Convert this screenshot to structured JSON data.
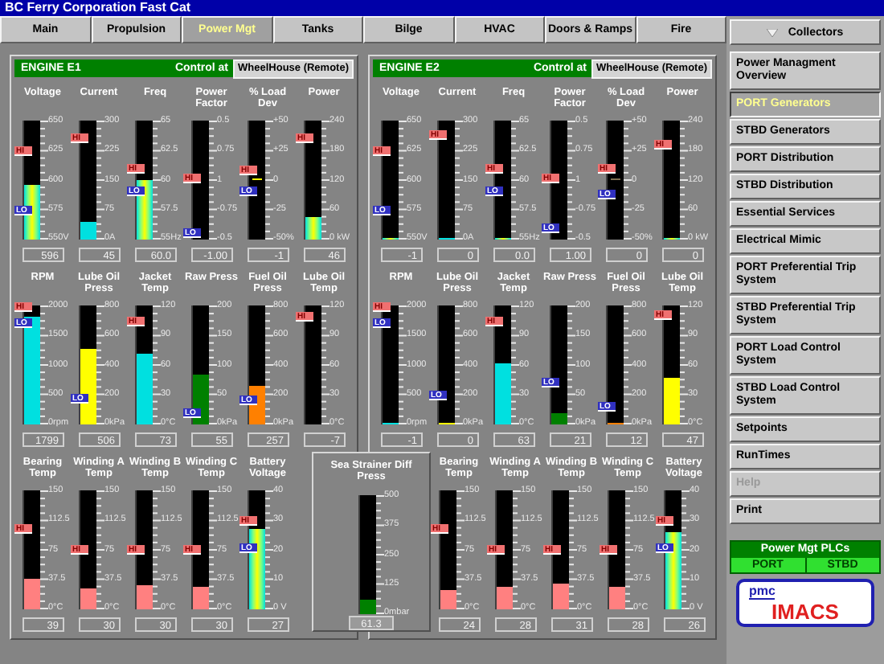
{
  "window": {
    "title": "BC Ferry Corporation Fast Cat"
  },
  "tabs": [
    {
      "label": "Main",
      "selected": false
    },
    {
      "label": "Propulsion",
      "selected": false
    },
    {
      "label": "Power Mgt",
      "selected": true
    },
    {
      "label": "Tanks",
      "selected": false
    },
    {
      "label": "Bilge",
      "selected": false
    },
    {
      "label": "HVAC",
      "selected": false
    },
    {
      "label": "Doors & Ramps",
      "selected": false
    },
    {
      "label": "Fire",
      "selected": false
    }
  ],
  "engines": [
    {
      "title": "ENGINE E1",
      "control_label": "Control at",
      "control_value": "WheelHouse (Remote)",
      "rows": [
        [
          {
            "label": "Voltage",
            "scale": [
              "650",
              "625",
              "600",
              "575",
              "550V"
            ],
            "kind": "gradient",
            "level": 0.46,
            "hi": {
              "label": "HI",
              "level": 0.75
            },
            "lo": {
              "label": "LO",
              "level": 0.25
            },
            "reading": "596"
          },
          {
            "label": "Current",
            "scale": [
              "300",
              "225",
              "150",
              "75",
              "0A"
            ],
            "kind": "solid",
            "color": "#00e0e0",
            "level": 0.15,
            "hi": {
              "label": "HI",
              "level": 0.85
            },
            "reading": "45"
          },
          {
            "label": "Freq",
            "scale": [
              "65",
              "62.5",
              "60",
              "57.5",
              "55Hz"
            ],
            "kind": "gradient",
            "level": 0.5,
            "hi": {
              "label": "HI",
              "level": 0.6
            },
            "lo": {
              "label": "LO",
              "level": 0.4
            },
            "reading": "60.0"
          },
          {
            "label": "Power Factor",
            "scale": [
              "0.5",
              "0.75",
              "1",
              "-0.75",
              "-0.5"
            ],
            "kind": "none",
            "hi": {
              "label": "HI",
              "level": 0.52
            },
            "lo": {
              "label": "LO",
              "level": 0.05
            },
            "reading": "-1.00"
          },
          {
            "label": "% Load Dev",
            "scale": [
              "+50",
              "+25",
              "0",
              "-25",
              "-50%"
            ],
            "kind": "line",
            "color": "#ffff00",
            "level": 0.5,
            "hi": {
              "label": "HI",
              "level": 0.58
            },
            "lo": {
              "label": "LO",
              "level": 0.4
            },
            "reading": "-1"
          },
          {
            "label": "Power",
            "scale": [
              "240",
              "180",
              "120",
              "60",
              "0 kW"
            ],
            "kind": "gradient",
            "level": 0.19,
            "hi": {
              "label": "HI",
              "level": 0.85
            },
            "reading": "46"
          }
        ],
        [
          {
            "label": "RPM",
            "scale": [
              "2000",
              "1500",
              "1000",
              "500",
              "0rpm"
            ],
            "kind": "solid",
            "color": "#00e0e0",
            "level": 0.9,
            "hi": {
              "label": "HI",
              "level": 0.98
            },
            "lo": {
              "label": "LO",
              "level": 0.85
            },
            "reading": "1799"
          },
          {
            "label": "Lube Oil Press",
            "scale": [
              "800",
              "600",
              "400",
              "200",
              "0kPa"
            ],
            "kind": "solid",
            "color": "#ffff00",
            "level": 0.63,
            "lo": {
              "label": "LO",
              "level": 0.22
            },
            "reading": "506"
          },
          {
            "label": "Jacket Temp",
            "scale": [
              "120",
              "90",
              "60",
              "30",
              "0°C"
            ],
            "kind": "solid",
            "color": "#00e0e0",
            "level": 0.6,
            "hi": {
              "label": "HI",
              "level": 0.87
            },
            "reading": "73"
          },
          {
            "label": "Raw Press",
            "scale": [
              "200",
              "150",
              "100",
              "50",
              "0kPa"
            ],
            "kind": "solid",
            "color": "#008000",
            "level": 0.42,
            "lo": {
              "label": "LO",
              "level": 0.1
            },
            "reading": "55"
          },
          {
            "label": "Fuel Oil Press",
            "scale": [
              "800",
              "600",
              "400",
              "200",
              "0kPa"
            ],
            "kind": "solid",
            "color": "#ff8000",
            "level": 0.32,
            "lo": {
              "label": "LO",
              "level": 0.2
            },
            "reading": "257"
          },
          {
            "label": "Lube Oil Temp",
            "scale": [
              "120",
              "90",
              "60",
              "30",
              "0°C"
            ],
            "kind": "none",
            "hi": {
              "label": "HI",
              "level": 0.9
            },
            "reading": "-7"
          }
        ]
      ],
      "lower_gauges": [
        {
          "label": "Bearing Temp",
          "scale": [
            "150",
            "112.5",
            "75",
            "37.5",
            "0°C"
          ],
          "kind": "solid",
          "color": "#ff8080",
          "level": 0.26,
          "hi": {
            "label": "HI",
            "level": 0.68
          },
          "reading": "39"
        },
        {
          "label": "Winding A Temp",
          "scale": [
            "150",
            "112.5",
            "75",
            "37.5",
            "0°C"
          ],
          "kind": "solid",
          "color": "#ff8080",
          "level": 0.18,
          "hi": {
            "label": "HI",
            "level": 0.5
          },
          "reading": "30"
        },
        {
          "label": "Winding B Temp",
          "scale": [
            "150",
            "112.5",
            "75",
            "37.5",
            "0°C"
          ],
          "kind": "solid",
          "color": "#ff8080",
          "level": 0.2,
          "hi": {
            "label": "HI",
            "level": 0.5
          },
          "reading": "30"
        },
        {
          "label": "Winding C Temp",
          "scale": [
            "150",
            "112.5",
            "75",
            "37.5",
            "0°C"
          ],
          "kind": "solid",
          "color": "#ff8080",
          "level": 0.19,
          "hi": {
            "label": "HI",
            "level": 0.5
          },
          "reading": "30"
        },
        {
          "label": "Battery Voltage",
          "scale": [
            "40",
            "30",
            "20",
            "10",
            "0 V"
          ],
          "kind": "gradient",
          "level": 0.68,
          "hi": {
            "label": "HI",
            "level": 0.75
          },
          "lo": {
            "label": "LO",
            "level": 0.52
          },
          "reading": "27"
        }
      ]
    },
    {
      "title": "ENGINE E2",
      "control_label": "Control at",
      "control_value": "WheelHouse (Remote)",
      "rows": [
        [
          {
            "label": "Voltage",
            "scale": [
              "650",
              "625",
              "600",
              "575",
              "550V"
            ],
            "kind": "gradient",
            "level": 0.01,
            "hi": {
              "label": "HI",
              "level": 0.75
            },
            "lo": {
              "label": "LO",
              "level": 0.25
            },
            "reading": "-1"
          },
          {
            "label": "Current",
            "scale": [
              "300",
              "225",
              "150",
              "75",
              "0A"
            ],
            "kind": "solid",
            "color": "#00e0e0",
            "level": 0.01,
            "hi": {
              "label": "HI",
              "level": 0.88
            },
            "reading": "0"
          },
          {
            "label": "Freq",
            "scale": [
              "65",
              "62.5",
              "60",
              "57.5",
              "55Hz"
            ],
            "kind": "gradient",
            "level": 0.01,
            "hi": {
              "label": "HI",
              "level": 0.6
            },
            "lo": {
              "label": "LO",
              "level": 0.4
            },
            "reading": "0.0"
          },
          {
            "label": "Power Factor",
            "scale": [
              "0.5",
              "0.75",
              "1",
              "-0.75",
              "-0.5"
            ],
            "kind": "none",
            "hi": {
              "label": "HI",
              "level": 0.52
            },
            "lo": {
              "label": "LO",
              "level": 0.1
            },
            "reading": "1.00"
          },
          {
            "label": "% Load Dev",
            "scale": [
              "+50",
              "+25",
              "0",
              "-25",
              "-50%"
            ],
            "kind": "line",
            "color": "#807050",
            "level": 0.5,
            "hi": {
              "label": "HI",
              "level": 0.6
            },
            "lo": {
              "label": "LO",
              "level": 0.38
            },
            "reading": "0"
          },
          {
            "label": "Power",
            "scale": [
              "240",
              "180",
              "120",
              "60",
              "0 kW"
            ],
            "kind": "gradient",
            "level": 0.01,
            "hi": {
              "label": "HI",
              "level": 0.8
            },
            "reading": "0"
          }
        ],
        [
          {
            "label": "RPM",
            "scale": [
              "2000",
              "1500",
              "1000",
              "500",
              "0rpm"
            ],
            "kind": "solid",
            "color": "#00e0e0",
            "level": 0.01,
            "hi": {
              "label": "HI",
              "level": 0.98
            },
            "lo": {
              "label": "LO",
              "level": 0.85
            },
            "reading": "-1"
          },
          {
            "label": "Lube Oil Press",
            "scale": [
              "800",
              "600",
              "400",
              "200",
              "0kPa"
            ],
            "kind": "solid",
            "color": "#ffff00",
            "level": 0.01,
            "lo": {
              "label": "LO",
              "level": 0.25
            },
            "reading": "0"
          },
          {
            "label": "Jacket Temp",
            "scale": [
              "120",
              "90",
              "60",
              "30",
              "0°C"
            ],
            "kind": "solid",
            "color": "#00e0e0",
            "level": 0.52,
            "hi": {
              "label": "HI",
              "level": 0.87
            },
            "reading": "63"
          },
          {
            "label": "Raw Press",
            "scale": [
              "200",
              "150",
              "100",
              "50",
              "0kPa"
            ],
            "kind": "solid",
            "color": "#008000",
            "level": 0.1,
            "lo": {
              "label": "LO",
              "level": 0.35
            },
            "reading": "21"
          },
          {
            "label": "Fuel Oil Press",
            "scale": [
              "800",
              "600",
              "400",
              "200",
              "0kPa"
            ],
            "kind": "solid",
            "color": "#ff8000",
            "level": 0.02,
            "lo": {
              "label": "LO",
              "level": 0.15
            },
            "reading": "12"
          },
          {
            "label": "Lube Oil Temp",
            "scale": [
              "120",
              "90",
              "60",
              "30",
              "0°C"
            ],
            "kind": "solid",
            "color": "#ffff00",
            "level": 0.39,
            "hi": {
              "label": "HI",
              "level": 0.92
            },
            "reading": "47"
          }
        ]
      ],
      "lower_gauges": [
        {
          "label": "Bearing Temp",
          "scale": [
            "150",
            "112.5",
            "75",
            "37.5",
            "0°C"
          ],
          "kind": "solid",
          "color": "#ff8080",
          "level": 0.16,
          "hi": {
            "label": "HI",
            "level": 0.68
          },
          "reading": "24"
        },
        {
          "label": "Winding A Temp",
          "scale": [
            "150",
            "112.5",
            "75",
            "37.5",
            "0°C"
          ],
          "kind": "solid",
          "color": "#ff8080",
          "level": 0.19,
          "hi": {
            "label": "HI",
            "level": 0.5
          },
          "reading": "28"
        },
        {
          "label": "Winding B Temp",
          "scale": [
            "150",
            "112.5",
            "75",
            "37.5",
            "0°C"
          ],
          "kind": "solid",
          "color": "#ff8080",
          "level": 0.21,
          "hi": {
            "label": "HI",
            "level": 0.5
          },
          "reading": "31"
        },
        {
          "label": "Winding C Temp",
          "scale": [
            "150",
            "112.5",
            "75",
            "37.5",
            "0°C"
          ],
          "kind": "solid",
          "color": "#ff8080",
          "level": 0.19,
          "hi": {
            "label": "HI",
            "level": 0.5
          },
          "reading": "28"
        },
        {
          "label": "Battery Voltage",
          "scale": [
            "40",
            "30",
            "20",
            "10",
            "0 V"
          ],
          "kind": "gradient",
          "level": 0.65,
          "hi": {
            "label": "HI",
            "level": 0.75
          },
          "lo": {
            "label": "LO",
            "level": 0.52
          },
          "reading": "26"
        }
      ]
    }
  ],
  "strainer": {
    "label": "Sea Strainer Diff Press",
    "scale": [
      "500",
      "375",
      "250",
      "125",
      "0mbar"
    ],
    "kind": "solid",
    "color": "#008000",
    "level": 0.12,
    "reading": "61.3"
  },
  "sidebar": {
    "header": "Collectors",
    "items": [
      {
        "label": "Power Managment Overview",
        "selected": false,
        "disabled": false
      },
      {
        "label": "PORT Generators",
        "selected": true,
        "disabled": false
      },
      {
        "label": "STBD Generators",
        "selected": false,
        "disabled": false
      },
      {
        "label": "PORT Distribution",
        "selected": false,
        "disabled": false
      },
      {
        "label": "STBD Distribution",
        "selected": false,
        "disabled": false
      },
      {
        "label": "Essential Services",
        "selected": false,
        "disabled": false
      },
      {
        "label": "Electrical Mimic",
        "selected": false,
        "disabled": false
      },
      {
        "label": "PORT Preferential Trip System",
        "selected": false,
        "disabled": false
      },
      {
        "label": "STBD Preferential Trip System",
        "selected": false,
        "disabled": false
      },
      {
        "label": "PORT Load Control System",
        "selected": false,
        "disabled": false
      },
      {
        "label": "STBD Load Control System",
        "selected": false,
        "disabled": false
      },
      {
        "label": "Setpoints",
        "selected": false,
        "disabled": false
      },
      {
        "label": "RunTimes",
        "selected": false,
        "disabled": false
      },
      {
        "label": "Help",
        "selected": false,
        "disabled": true
      },
      {
        "label": "Print",
        "selected": false,
        "disabled": false
      }
    ]
  },
  "plc": {
    "title": "Power Mgt PLCs",
    "items": [
      "PORT",
      "STBD"
    ]
  },
  "logo": {
    "small": "pmc",
    "large": "IMACS"
  }
}
